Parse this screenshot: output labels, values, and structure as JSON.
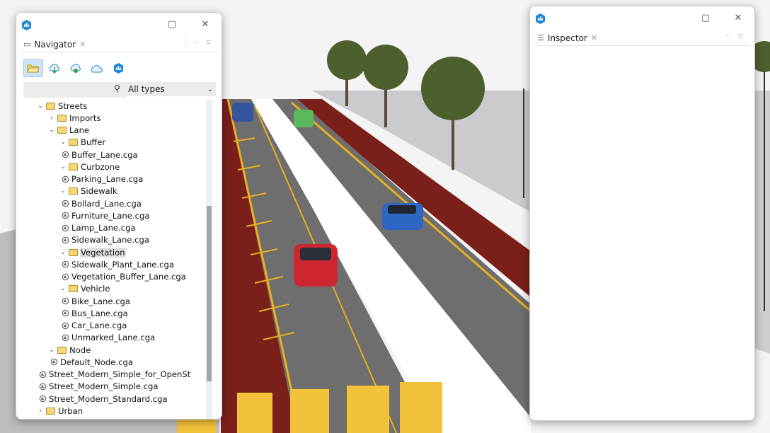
{
  "navigator": {
    "tab_label": "Navigator",
    "tab_icon": "panel-icon",
    "toolbar": [
      "folder-open-icon",
      "cloud-download-icon",
      "cloud-share-icon",
      "cloud-icon",
      "cityengine-icon"
    ],
    "search": {
      "value": "",
      "placeholder": ""
    },
    "filter": {
      "selected": "All types"
    },
    "tree": [
      {
        "label": "Streets",
        "kind": "folder",
        "depth": 1,
        "expanded": true
      },
      {
        "label": "Imports",
        "kind": "folder",
        "depth": 2,
        "expanded": false
      },
      {
        "label": "Lane",
        "kind": "folder",
        "depth": 2,
        "expanded": true
      },
      {
        "label": "Buffer",
        "kind": "folder",
        "depth": 3,
        "expanded": true
      },
      {
        "label": "Buffer_Lane.cga",
        "kind": "file",
        "depth": 4
      },
      {
        "label": "Curbzone",
        "kind": "folder",
        "depth": 3,
        "expanded": true
      },
      {
        "label": "Parking_Lane.cga",
        "kind": "file",
        "depth": 4
      },
      {
        "label": "Sidewalk",
        "kind": "folder",
        "depth": 3,
        "expanded": true
      },
      {
        "label": "Bollard_Lane.cga",
        "kind": "file",
        "depth": 4
      },
      {
        "label": "Furniture_Lane.cga",
        "kind": "file",
        "depth": 4
      },
      {
        "label": "Lamp_Lane.cga",
        "kind": "file",
        "depth": 4
      },
      {
        "label": "Sidewalk_Lane.cga",
        "kind": "file",
        "depth": 4
      },
      {
        "label": "Vegetation",
        "kind": "folder",
        "depth": 3,
        "expanded": true,
        "selected": true
      },
      {
        "label": "Sidewalk_Plant_Lane.cga",
        "kind": "file",
        "depth": 4
      },
      {
        "label": "Vegetation_Buffer_Lane.cga",
        "kind": "file",
        "depth": 4
      },
      {
        "label": "Vehicle",
        "kind": "folder",
        "depth": 3,
        "expanded": true
      },
      {
        "label": "Bike_Lane.cga",
        "kind": "file",
        "depth": 4
      },
      {
        "label": "Bus_Lane.cga",
        "kind": "file",
        "depth": 4
      },
      {
        "label": "Car_Lane.cga",
        "kind": "file",
        "depth": 4
      },
      {
        "label": "Unmarked_Lane.cga",
        "kind": "file",
        "depth": 4
      },
      {
        "label": "Node",
        "kind": "folder",
        "depth": 2,
        "expanded": true
      },
      {
        "label": "Default_Node.cga",
        "kind": "file",
        "depth": 3
      },
      {
        "label": "Street_Modern_Simple_for_OpenSt",
        "kind": "file",
        "depth": 2
      },
      {
        "label": "Street_Modern_Simple.cga",
        "kind": "file",
        "depth": 2
      },
      {
        "label": "Street_Modern_Standard.cga",
        "kind": "file",
        "depth": 2
      },
      {
        "label": "Urban",
        "kind": "folder",
        "depth": 1,
        "expanded": false
      }
    ]
  },
  "inspector": {
    "tab_label": "Inspector",
    "tab_icon": "sliders-icon"
  },
  "window_controls": {
    "maximize": "▢",
    "close": "✕"
  },
  "colors": {
    "accent": "#1a87d8",
    "bike_lane": "#7a1f1a",
    "road": "#6d6d6d",
    "yellow": "#e8b021"
  }
}
